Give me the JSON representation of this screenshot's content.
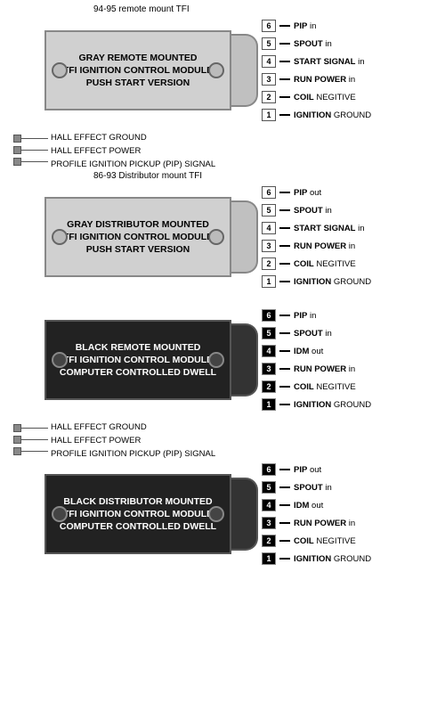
{
  "modules": [
    {
      "id": "gray-remote",
      "topLabel": "94-95 remote mount TFI",
      "boxColor": "gray",
      "title": "GRAY REMOTE MOUNTED\nTFI IGNITION CONTROL MODULE\nPUSH START VERSION",
      "pins": [
        {
          "num": 6,
          "label": "PIP in",
          "bold": [
            "PIP"
          ]
        },
        {
          "num": 5,
          "label": "SPOUT in",
          "bold": [
            "SPOUT"
          ]
        },
        {
          "num": 4,
          "label": "START SIGNAL in",
          "bold": [
            "START SIGNAL"
          ]
        },
        {
          "num": 3,
          "label": "RUN POWER in",
          "bold": [
            "RUN POWER"
          ]
        },
        {
          "num": 2,
          "label": "COIL NEGITIVE",
          "bold": [
            "COIL"
          ]
        },
        {
          "num": 1,
          "label": "IGNITION GROUND",
          "bold": [
            "IGNITION"
          ]
        }
      ],
      "hasHallEffect": false
    },
    {
      "id": "gray-distributor",
      "topLabel": "86-93 Distributor mount TFI",
      "boxColor": "gray",
      "title": "GRAY DISTRIBUTOR MOUNTED\nTFI IGNITION CONTROL MODULE\nPUSH START VERSION",
      "pins": [
        {
          "num": 6,
          "label": "PIP out",
          "bold": [
            "PIP"
          ]
        },
        {
          "num": 5,
          "label": "SPOUT in",
          "bold": [
            "SPOUT"
          ]
        },
        {
          "num": 4,
          "label": "START SIGNAL in",
          "bold": [
            "START SIGNAL"
          ]
        },
        {
          "num": 3,
          "label": "RUN POWER in",
          "bold": [
            "RUN POWER"
          ]
        },
        {
          "num": 2,
          "label": "COIL NEGITIVE",
          "bold": [
            "COIL"
          ]
        },
        {
          "num": 1,
          "label": "IGNITION GROUND",
          "bold": [
            "IGNITION"
          ]
        }
      ],
      "hasHallEffect": true,
      "hallLabels": [
        "HALL EFFECT GROUND",
        "HALL EFFECT POWER",
        "PROFILE IGNITION PICKUP (PIP) SIGNAL"
      ]
    },
    {
      "id": "black-remote",
      "topLabel": null,
      "boxColor": "black",
      "title": "BLACK REMOTE MOUNTED\nTFI IGNITION CONTROL MODULE\nCOMPUTER CONTROLLED DWELL",
      "pins": [
        {
          "num": 6,
          "label": "PIP in",
          "bold": [
            "PIP"
          ]
        },
        {
          "num": 5,
          "label": "SPOUT in",
          "bold": [
            "SPOUT"
          ]
        },
        {
          "num": 4,
          "label": "IDM out",
          "bold": [
            "IDM"
          ]
        },
        {
          "num": 3,
          "label": "RUN POWER in",
          "bold": [
            "RUN POWER"
          ]
        },
        {
          "num": 2,
          "label": "COIL NEGITIVE",
          "bold": [
            "COIL"
          ]
        },
        {
          "num": 1,
          "label": "IGNITION GROUND",
          "bold": [
            "IGNITION"
          ]
        }
      ],
      "hasHallEffect": false
    },
    {
      "id": "black-distributor",
      "topLabel": null,
      "boxColor": "black",
      "title": "BLACK DISTRIBUTOR MOUNTED\nTFI IGNITION CONTROL MODULE\nCOMPUTER CONTROLLED DWELL",
      "pins": [
        {
          "num": 6,
          "label": "PIP out",
          "bold": [
            "PIP"
          ]
        },
        {
          "num": 5,
          "label": "SPOUT in",
          "bold": [
            "SPOUT"
          ]
        },
        {
          "num": 4,
          "label": "IDM out",
          "bold": [
            "IDM"
          ]
        },
        {
          "num": 3,
          "label": "RUN POWER in",
          "bold": [
            "RUN POWER"
          ]
        },
        {
          "num": 2,
          "label": "COIL NEGITIVE",
          "bold": [
            "COIL"
          ]
        },
        {
          "num": 1,
          "label": "IGNITION GROUND",
          "bold": [
            "IGNITION"
          ]
        }
      ],
      "hasHallEffect": true,
      "hallLabels": [
        "HALL EFFECT GROUND",
        "HALL EFFECT POWER",
        "PROFILE IGNITION PICKUP (PIP) SIGNAL"
      ]
    }
  ]
}
